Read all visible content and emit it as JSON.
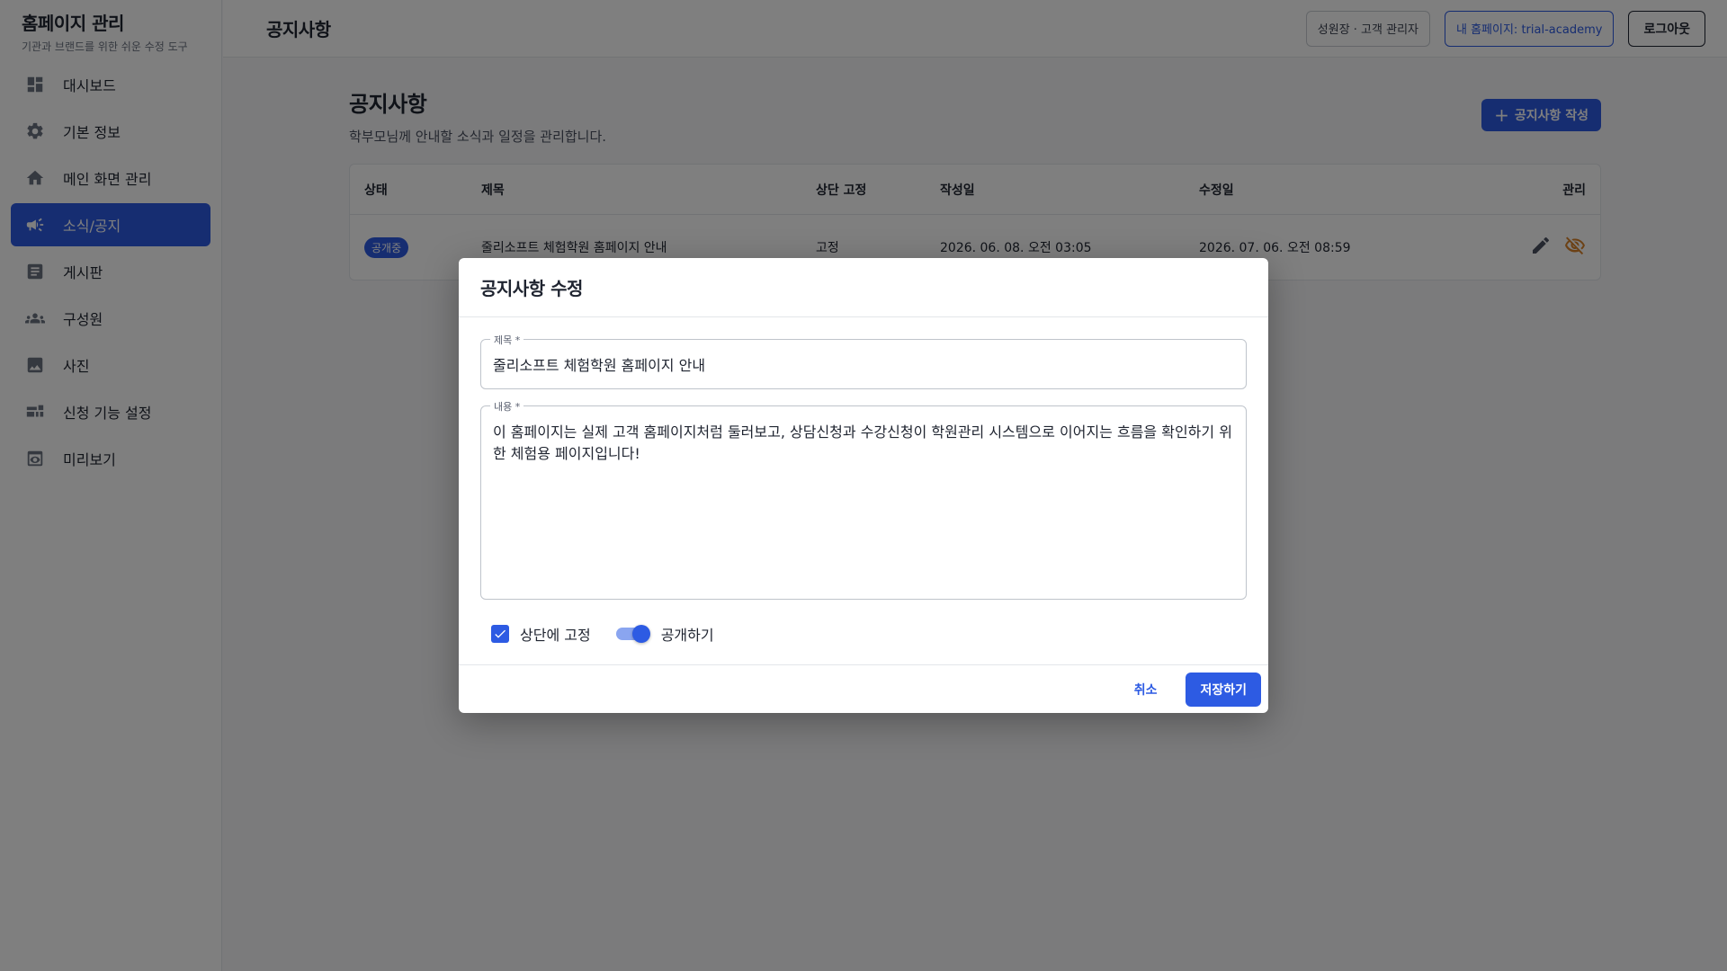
{
  "sidebar": {
    "brand_title": "홈페이지 관리",
    "brand_subtitle": "기관과 브랜드를 위한 쉬운 수정 도구",
    "items": [
      {
        "label": "대시보드",
        "icon": "dashboard-icon"
      },
      {
        "label": "기본 정보",
        "icon": "gear-icon"
      },
      {
        "label": "메인 화면 관리",
        "icon": "home-icon"
      },
      {
        "label": "소식/공지",
        "icon": "megaphone-icon",
        "active": true
      },
      {
        "label": "게시판",
        "icon": "article-icon"
      },
      {
        "label": "구성원",
        "icon": "group-icon"
      },
      {
        "label": "사진",
        "icon": "image-icon"
      },
      {
        "label": "신청 기능 설정",
        "icon": "form-settings-icon"
      },
      {
        "label": "미리보기",
        "icon": "preview-icon"
      }
    ]
  },
  "topbar": {
    "title": "공지사항",
    "user_chip": "성원장 · 고객 관리자",
    "site_chip": "내 홈페이지: trial-academy",
    "logout_label": "로그아웃"
  },
  "page": {
    "title": "공지사항",
    "subtitle": "학부모님께 안내할 소식과 일정을 관리합니다.",
    "create_button": "공지사항 작성"
  },
  "table": {
    "headers": [
      "상태",
      "제목",
      "상단 고정",
      "작성일",
      "수정일",
      "관리"
    ],
    "rows": [
      {
        "status": "공개중",
        "title": "줄리소프트 체험학원 홈페이지 안내",
        "pinned": "고정",
        "created": "2026. 06. 08. 오전 03:05",
        "updated": "2026. 07. 06. 오전 08:59"
      }
    ]
  },
  "dialog": {
    "title": "공지사항 수정",
    "title_field_label": "제목 *",
    "title_field_value": "줄리소프트 체험학원 홈페이지 안내",
    "body_field_label": "내용 *",
    "body_field_value": "이 홈페이지는 실제 고객 홈페이지처럼 둘러보고, 상담신청과 수강신청이 학원관리 시스템으로 이어지는 흐름을 확인하기 위한 체험용 페이지입니다!",
    "pin_label": "상단에 고정",
    "pin_checked": true,
    "public_label": "공개하기",
    "public_on": true,
    "cancel_label": "취소",
    "save_label": "저장하기"
  },
  "colors": {
    "primary": "#2d5be3",
    "hide_icon": "#d9822b"
  }
}
